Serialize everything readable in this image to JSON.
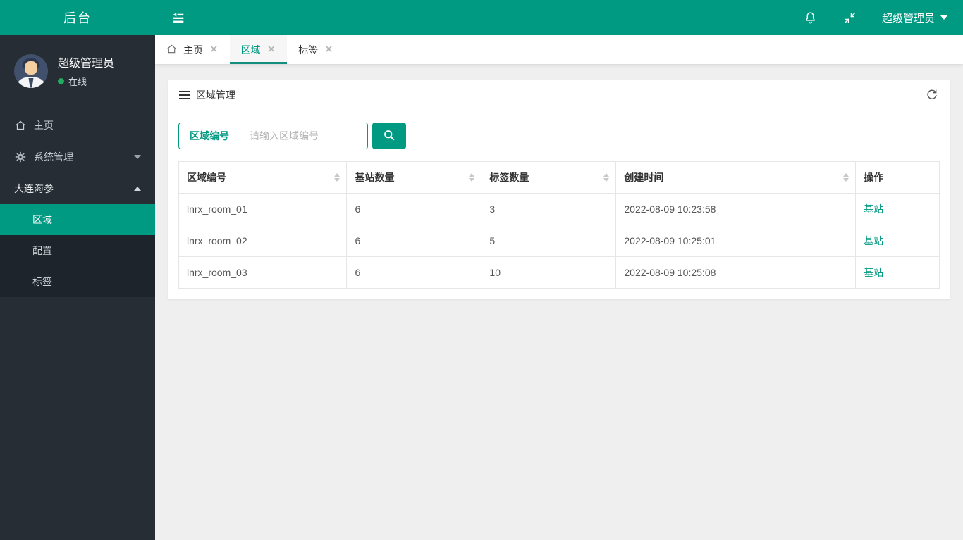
{
  "colors": {
    "accent": "#009982",
    "sidebar_bg": "#262d35",
    "submenu_bg": "#1d242b",
    "online_dot": "#23ab60",
    "content_bg": "#efefef"
  },
  "topbar": {
    "logo": "后台",
    "user_dropdown": "超级管理员"
  },
  "sidebar": {
    "user": {
      "name": "超级管理员",
      "status": "在线"
    },
    "items": [
      {
        "label": "主页"
      },
      {
        "label": "系统管理"
      },
      {
        "label": "大连海参"
      }
    ],
    "submenu": [
      {
        "label": "区域",
        "active": true
      },
      {
        "label": "配置"
      },
      {
        "label": "标签"
      }
    ]
  },
  "tabs": [
    {
      "label": "主页"
    },
    {
      "label": "区域",
      "active": true
    },
    {
      "label": "标签"
    }
  ],
  "panel": {
    "title": "区域管理",
    "search": {
      "field_label": "区域编号",
      "placeholder": "请输入区域编号"
    },
    "table": {
      "columns": [
        "区域编号",
        "基站数量",
        "标签数量",
        "创建时间",
        "操作"
      ],
      "rows": [
        {
          "region_id": "lnrx_room_01",
          "station_count": "6",
          "tag_count": "3",
          "created_at": "2022-08-09 10:23:58",
          "action": "基站"
        },
        {
          "region_id": "lnrx_room_02",
          "station_count": "6",
          "tag_count": "5",
          "created_at": "2022-08-09 10:25:01",
          "action": "基站"
        },
        {
          "region_id": "lnrx_room_03",
          "station_count": "6",
          "tag_count": "10",
          "created_at": "2022-08-09 10:25:08",
          "action": "基站"
        }
      ]
    }
  }
}
